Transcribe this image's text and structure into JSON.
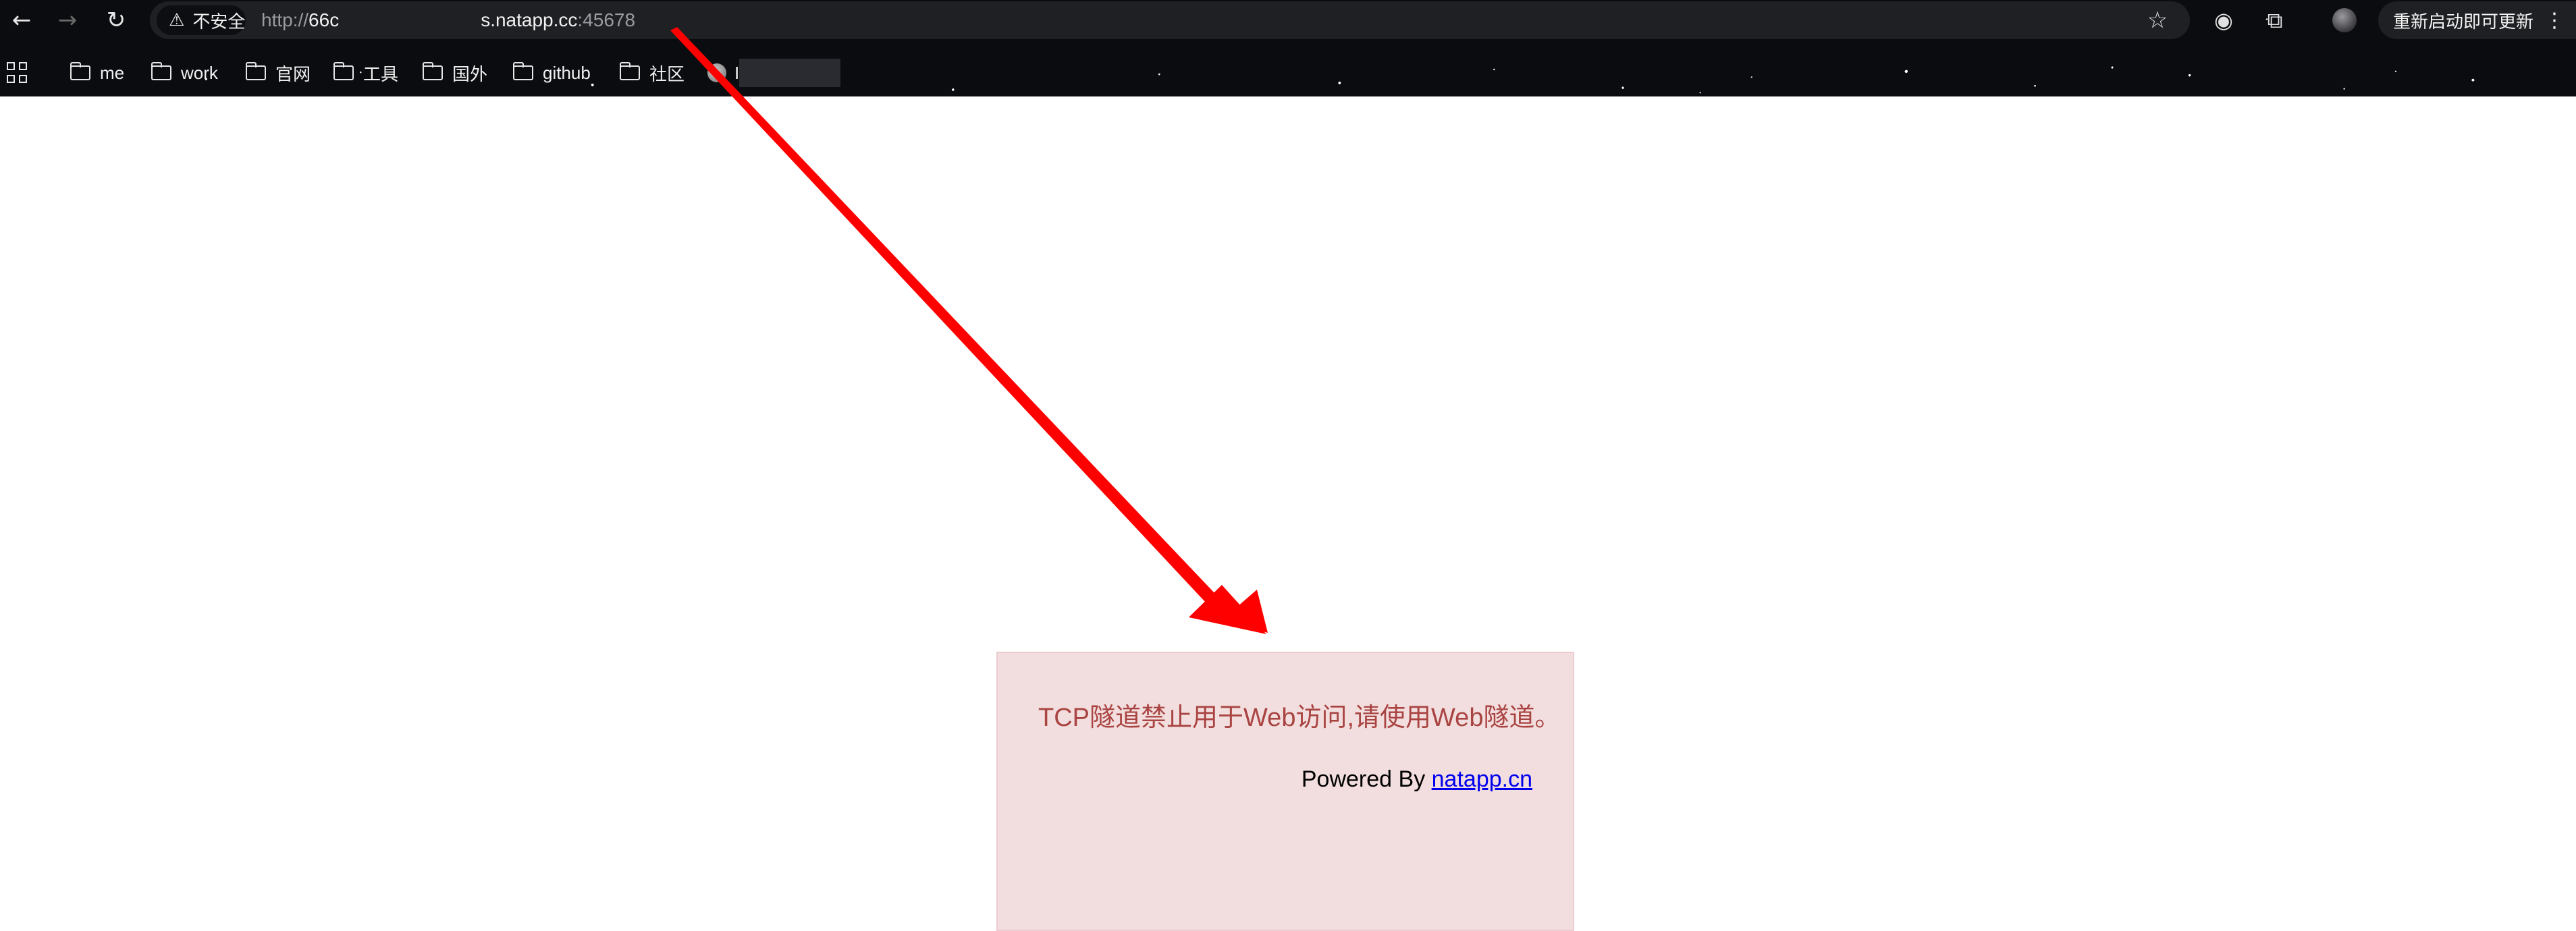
{
  "toolbar": {
    "back_icon": "arrow-left-icon",
    "forward_icon": "arrow-right-icon",
    "reload_icon": "reload-icon",
    "security_label": "不安全",
    "url_scheme": "http://",
    "url_host_start": "66c",
    "url_host_end": "s.natapp.cc",
    "url_port": ":45678",
    "update_label": "重新启动即可更新"
  },
  "bookmarks": [
    {
      "label": "me"
    },
    {
      "label": "work"
    },
    {
      "label": "官网"
    },
    {
      "label": "工具"
    },
    {
      "label": "国外"
    },
    {
      "label": "github"
    },
    {
      "label": "社区"
    },
    {
      "label": "I"
    }
  ],
  "notice": {
    "message": "TCP隧道禁止用于Web访问,请使用Web隧道。",
    "powered_prefix": "Powered By ",
    "powered_link": "natapp.cn"
  },
  "colors": {
    "notice_bg": "#f2dede",
    "notice_text": "#a94442",
    "annotation_arrow": "#ff0000"
  }
}
